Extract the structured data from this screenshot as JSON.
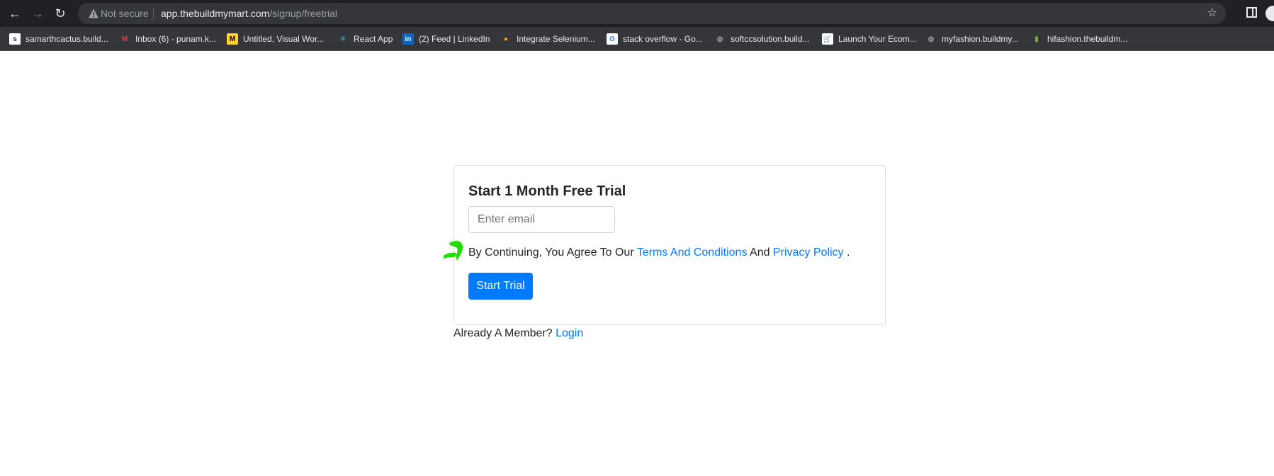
{
  "browser": {
    "security_label": "Not secure",
    "url_host": "app.thebuildmymart.com",
    "url_path": "/signup/freetrial",
    "bookmarks": [
      {
        "label": "samarthcactus.build...",
        "icon": "s",
        "icon_bg": "#ffffff",
        "icon_fg": "#333333"
      },
      {
        "label": "Inbox (6) - punam.k...",
        "icon": "M",
        "icon_bg": "#35363a",
        "icon_fg": "#ea4335"
      },
      {
        "label": "Untitled, Visual Wor...",
        "icon": "M",
        "icon_bg": "#ffd02f",
        "icon_fg": "#050038"
      },
      {
        "label": "React App",
        "icon": "⚛",
        "icon_bg": "#35363a",
        "icon_fg": "#61dafb"
      },
      {
        "label": "(2) Feed | LinkedIn",
        "icon": "in",
        "icon_bg": "#0a66c2",
        "icon_fg": "#ffffff"
      },
      {
        "label": "Integrate Selenium...",
        "icon": "●",
        "icon_bg": "#35363a",
        "icon_fg": "#f5a623"
      },
      {
        "label": "stack overflow - Go...",
        "icon": "G",
        "icon_bg": "#ffffff",
        "icon_fg": "#4285f4"
      },
      {
        "label": "softccsolution.build...",
        "icon": "◍",
        "icon_bg": "#35363a",
        "icon_fg": "#bdc1c6"
      },
      {
        "label": "Launch Your Ecom...",
        "icon": "🛒",
        "icon_bg": "#ffffff",
        "icon_fg": "#c2185b"
      },
      {
        "label": "myfashion.buildmy...",
        "icon": "◍",
        "icon_bg": "#35363a",
        "icon_fg": "#bdc1c6"
      },
      {
        "label": "hifashion.thebuildm...",
        "icon": "▮",
        "icon_bg": "#35363a",
        "icon_fg": "#7cb342"
      }
    ]
  },
  "signup": {
    "title": "Start 1 Month Free Trial",
    "email_placeholder": "Enter email",
    "agree_prefix": "By Continuing, You Agree To Our",
    "terms_link": "Terms And Conditions",
    "and_text": "And",
    "privacy_link": "Privacy Policy",
    "agree_suffix": ".",
    "submit_label": "Start Trial",
    "member_text": "Already A Member?",
    "login_link": "Login"
  },
  "colors": {
    "link": "#007bff",
    "button": "#007bff",
    "pointer": "#22dd00"
  }
}
